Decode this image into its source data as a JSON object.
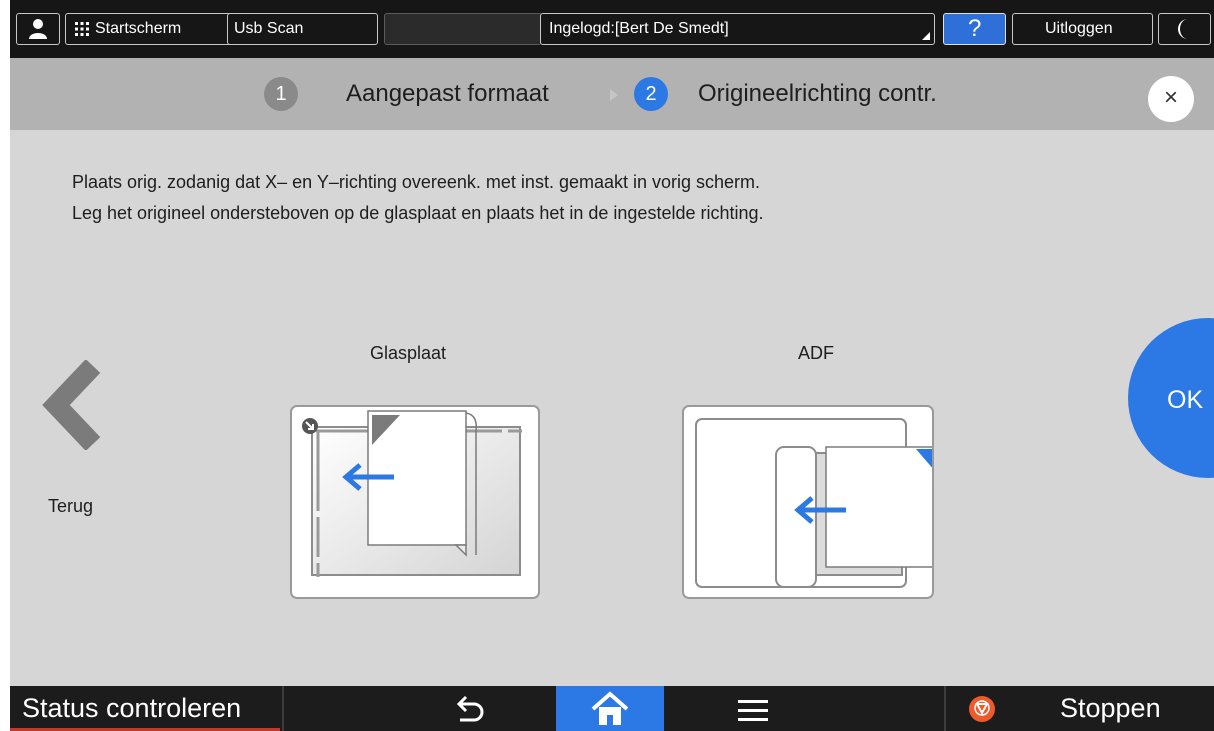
{
  "topbar": {
    "user_icon": "user-icon",
    "home_icon": "grid-icon",
    "home_label": "Startscherm",
    "usb_label": "Usb Scan",
    "login_label": "Ingelogd:[Bert De Smedt]",
    "help_label": "?",
    "logout_label": "Uitloggen",
    "energy_icon": "moon-icon"
  },
  "wizard": {
    "step1": {
      "number": "1",
      "label": "Aangepast formaat",
      "state": "done"
    },
    "step2": {
      "number": "2",
      "label": "Origineelrichting contr.",
      "state": "active"
    },
    "close_icon": "close-icon",
    "close_label": "×"
  },
  "instructions": {
    "line1": "Plaats orig. zodanig dat X– en Y–richting overeenk. met inst. gemaakt in vorig scherm.",
    "line2": "Leg het origineel ondersteboven op de glasplaat en plaats het in de ingestelde richting."
  },
  "options": {
    "glass_label": "Glasplaat",
    "adf_label": "ADF"
  },
  "nav": {
    "back_icon": "chevron-left-icon",
    "back_label": "Terug",
    "ok_label": "OK"
  },
  "bottombar": {
    "status_label": "Status controleren",
    "return_icon": "return-icon",
    "home_icon": "home-icon",
    "menu_icon": "menu-icon",
    "stop_icon": "stop-icon",
    "stop_label": "Stoppen"
  },
  "colors": {
    "accent_blue": "#2c78e4",
    "screen_bg": "#d6d6d6",
    "header_bg": "#b2b2b2",
    "topbar_bg": "#161616",
    "stop_orange": "#ef5a2a"
  }
}
